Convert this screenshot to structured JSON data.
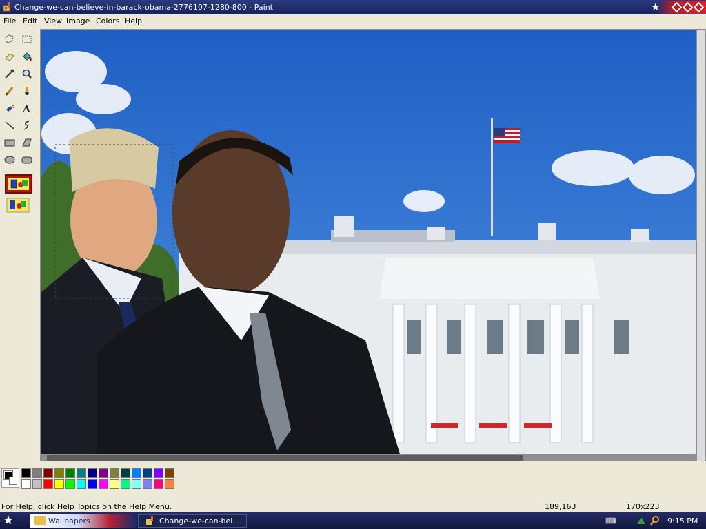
{
  "window": {
    "title": "Change-we-can-believe-in-barack-obama-2776107-1280-800 - Paint"
  },
  "menus": [
    "File",
    "Edit",
    "View",
    "Image",
    "Colors",
    "Help"
  ],
  "tools": [
    "free-form-select",
    "select",
    "eraser",
    "fill-with-color",
    "pick-color",
    "magnifier",
    "pencil",
    "brush",
    "airbrush",
    "text",
    "line",
    "curve",
    "rectangle",
    "polygon",
    "ellipse",
    "rounded-rectangle"
  ],
  "palette": {
    "foreground": "#000000",
    "background": "#ffffff",
    "row1": [
      "#000000",
      "#808080",
      "#800000",
      "#808000",
      "#008000",
      "#008080",
      "#000080",
      "#800080",
      "#808040",
      "#004040",
      "#0080ff",
      "#004080",
      "#8000ff",
      "#804000"
    ],
    "row2": [
      "#ffffff",
      "#c0c0c0",
      "#ff0000",
      "#ffff00",
      "#00ff00",
      "#00ffff",
      "#0000ff",
      "#ff00ff",
      "#ffff80",
      "#00ff80",
      "#80ffff",
      "#8080ff",
      "#ff0080",
      "#ff8040"
    ]
  },
  "status": {
    "help": "For Help, click Help Topics on the Help Menu.",
    "coords": "189,163",
    "size": "170x223"
  },
  "taskbar": {
    "items": [
      {
        "label": "Wallpapers",
        "icon": "folder-icon"
      },
      {
        "label": "Change-we-can-bel...",
        "icon": "paint-icon"
      }
    ],
    "clock": "9:15 PM"
  }
}
